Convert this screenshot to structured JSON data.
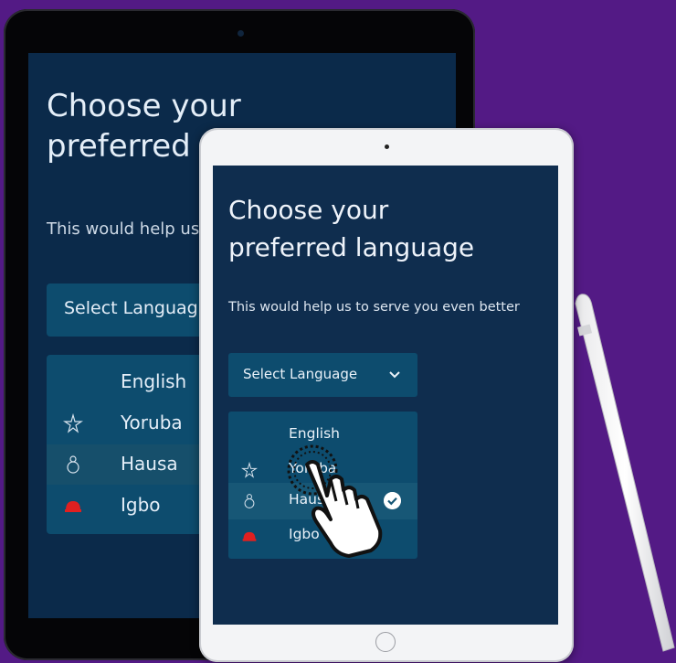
{
  "back_screen": {
    "title_line1": "Choose your",
    "title_line2": "preferred",
    "subtitle": "This would help us",
    "select_label": "Select Languag",
    "languages": [
      "English",
      "Yoruba",
      "Hausa",
      "Igbo"
    ]
  },
  "front_screen": {
    "title_line1": "Choose your",
    "title_line2": "preferred language",
    "subtitle": "This would help us to serve you even better",
    "select_label": "Select Language",
    "languages": [
      {
        "label": "English",
        "icon": "none"
      },
      {
        "label": "Yoruba",
        "icon": "yoruba-symbol-icon"
      },
      {
        "label": "Hausa",
        "icon": "hausa-symbol-icon",
        "selected": true
      },
      {
        "label": "Igbo",
        "icon": "igbo-cap-icon"
      }
    ]
  },
  "colors": {
    "background": "#531a85",
    "screen": "#0f2d4e",
    "panel": "#0d4c6e",
    "igbo_icon": "#e02020"
  }
}
